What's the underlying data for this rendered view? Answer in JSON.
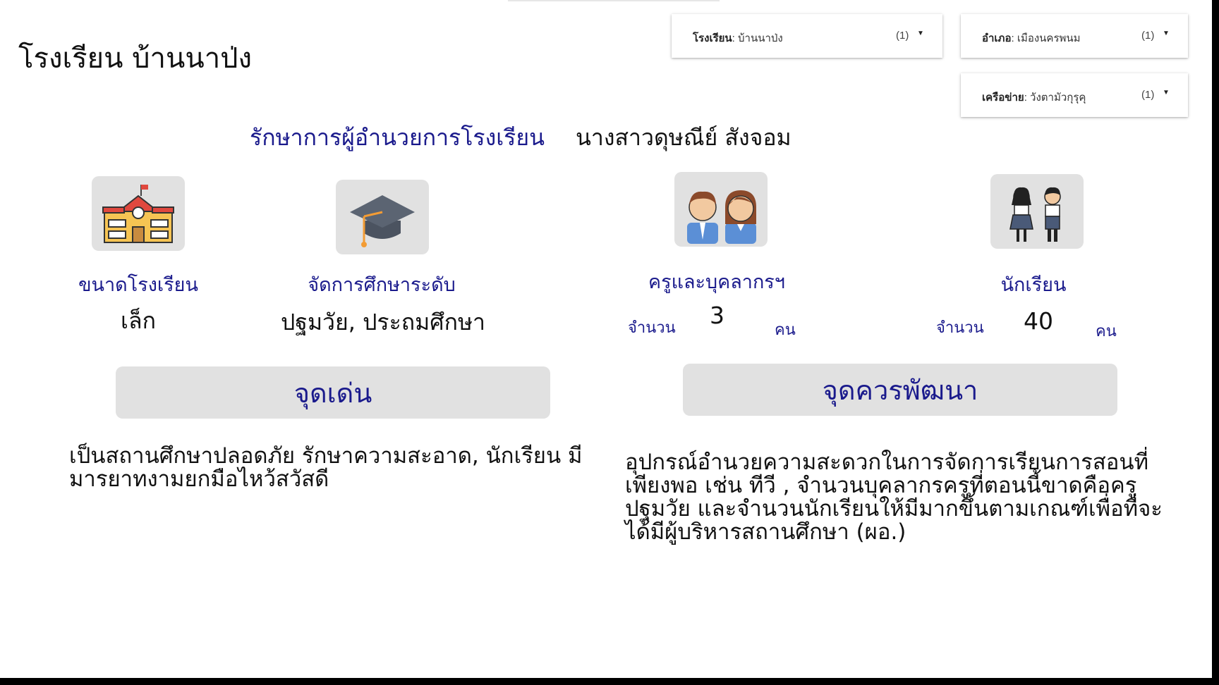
{
  "page_title": "โรงเรียน บ้านนาป่ง",
  "filters": [
    {
      "key": "โรงเรียน",
      "value": "บ้านนาป่ง",
      "count": "(1)"
    },
    {
      "key": "อำเภอ",
      "value": "เมืองนครพนม",
      "count": "(1)"
    },
    {
      "key": "เครือข่าย",
      "value": "วังตามัวกุรุคุ",
      "count": "(1)"
    }
  ],
  "principal": {
    "role": "รักษาการผู้อำนวยการโรงเรียน",
    "name": "นางสาวดุษณีย์ สังจอม"
  },
  "school_size": {
    "label": "ขนาดโรงเรียน",
    "value": "เล็ก",
    "icon": "school-building-icon"
  },
  "education_level": {
    "label": "จัดการศึกษาระดับ",
    "value": "ปฐมวัย, ประถมศึกษา",
    "icon": "graduation-cap-icon"
  },
  "teachers": {
    "label": "ครูและบุคลากรฯ",
    "count_label": "จำนวน",
    "value": "3",
    "unit": "คน",
    "icon": "teachers-icon"
  },
  "students": {
    "label": "นักเรียน",
    "count_label": "จำนวน",
    "value": "40",
    "unit": "คน",
    "icon": "students-icon"
  },
  "strengths": {
    "title": "จุดเด่น",
    "text": "เป็นสถานศึกษาปลอดภัย รักษาความสะอาด, นักเรียน มีมารยาทงามยกมือไหว้สวัสดี"
  },
  "improvements": {
    "title": "จุดควรพัฒนา",
    "text": "อุปกรณ์อำนวยความสะดวกในการจัดการเรียนการสอนที่เพียงพอ เช่น ทีวี , จำนวนบุคลากรครูที่ตอนนี้ขาดคือครูปฐมวัย และจำนวนนักเรียนให้มีมากขึ้นตามเกณฑ์เพื่อที่จะได้มีผู้บริหารสถานศึกษา (ผอ.)"
  },
  "colors": {
    "accent": "#1a1a8c",
    "tile": "#e1e1e1",
    "frame": "#000000"
  }
}
